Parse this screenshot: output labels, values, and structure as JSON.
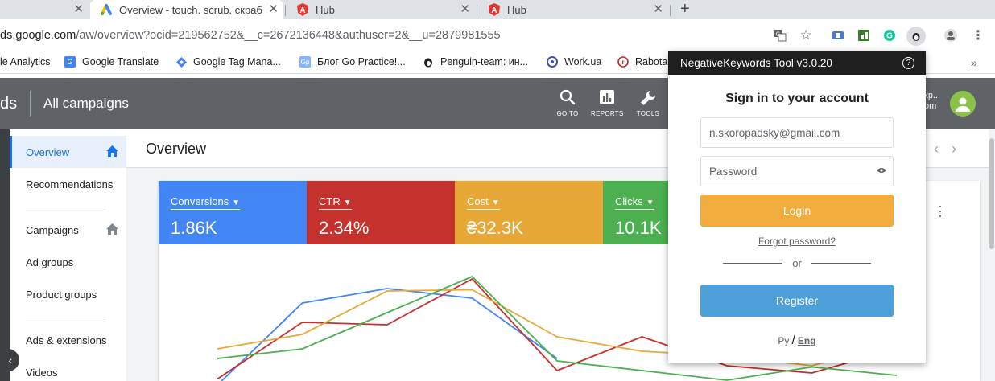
{
  "browser": {
    "tabs": [
      {
        "title": ""
      },
      {
        "title": "Overview - touch. scrub. скраб"
      },
      {
        "title": "Hub"
      },
      {
        "title": "Hub"
      }
    ],
    "url_domain": "ds.google.com",
    "url_path": "/aw/overview?ocid=219562752&__c=2672136448&authuser=2&__u=2879981555"
  },
  "bookmarks": [
    {
      "label": "le Analytics",
      "icon": "analytics-icon"
    },
    {
      "label": "Google Translate",
      "icon": "translate-icon"
    },
    {
      "label": "Google Tag Mana...",
      "icon": "tag-manager-icon"
    },
    {
      "label": "Блог Go Practice!...",
      "icon": "gp-icon"
    },
    {
      "label": "Penguin-team: ин...",
      "icon": "penguin-icon"
    },
    {
      "label": "Work.ua",
      "icon": "workua-icon"
    },
    {
      "label": "Rabota",
      "icon": "rabota-icon"
    }
  ],
  "ads": {
    "brand_fragment": "ds",
    "header_title": "All campaigns",
    "header_buttons": [
      {
        "label": "GO TO",
        "icon": "search-icon"
      },
      {
        "label": "REPORTS",
        "icon": "reports-icon"
      },
      {
        "label": "TOOLS",
        "icon": "wrench-icon"
      }
    ],
    "account_fragment_1": "кр...",
    "account_fragment_2": "om",
    "page_title": "Overview",
    "sidebar": [
      {
        "label": "Overview"
      },
      {
        "label": "Recommendations"
      },
      {
        "label": "Campaigns"
      },
      {
        "label": "Ad groups"
      },
      {
        "label": "Product groups"
      },
      {
        "label": "Ads & extensions"
      },
      {
        "label": "Videos"
      }
    ],
    "metrics": [
      {
        "name": "Conversions",
        "value": "1.86K",
        "color": "#4285f4"
      },
      {
        "name": "CTR",
        "value": "2.34%",
        "color": "#c5312c"
      },
      {
        "name": "Cost",
        "value": "₴32.3K",
        "color": "#e8a838"
      },
      {
        "name": "Clicks",
        "value": "10.1K",
        "color": "#4caf50"
      }
    ]
  },
  "popup": {
    "title": "NegativeKeywords Tool v3.0.20",
    "heading": "Sign in to your account",
    "email_value": "n.skoropadsky@gmail.com",
    "password_placeholder": "Password",
    "login_label": "Login",
    "forgot_label": "Forgot password?",
    "or_label": "or",
    "register_label": "Register",
    "lang_ru": "Ру",
    "lang_sep": "/",
    "lang_en": "Eng",
    "colors": {
      "login": "#f0ad3e",
      "register": "#4ea0d8",
      "header": "#1f1f1f"
    }
  },
  "chart_data": {
    "type": "line",
    "title": "",
    "xlabel": "",
    "ylabel": "",
    "ylim": [
      0,
      100
    ],
    "x": [
      0,
      1,
      2,
      3,
      4,
      5,
      6,
      7,
      8
    ],
    "series": [
      {
        "color": "#4285f4",
        "values": [
          0,
          68,
          80,
          72,
          22,
          null,
          null,
          null,
          null
        ]
      },
      {
        "color": "#c5312c",
        "values": [
          5,
          52,
          50,
          88,
          12,
          40,
          16,
          10,
          30
        ]
      },
      {
        "color": "#e8a838",
        "values": [
          30,
          42,
          78,
          79,
          40,
          28,
          24,
          16,
          35
        ]
      },
      {
        "color": "#4caf50",
        "values": [
          22,
          30,
          60,
          90,
          20,
          12,
          4,
          15,
          8
        ]
      }
    ]
  }
}
